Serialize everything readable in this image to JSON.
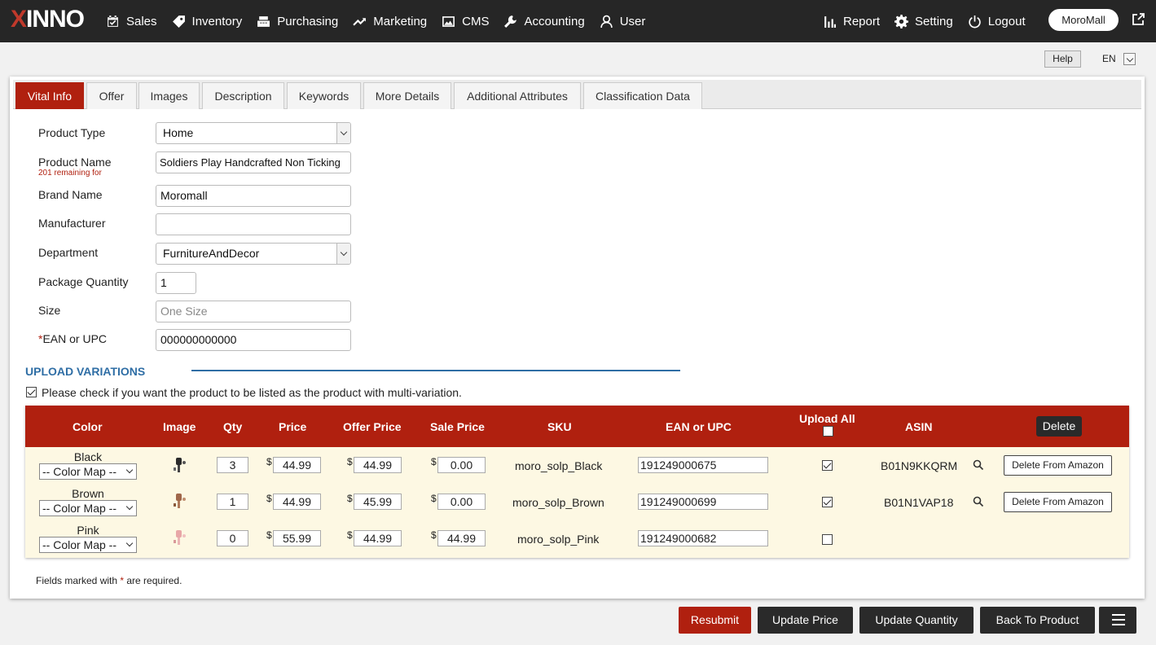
{
  "app": {
    "logo": "XINNO",
    "store": "MoroMall",
    "lang": "EN",
    "help": "Help"
  },
  "nav": {
    "left": [
      {
        "label": "Sales",
        "icon": "calendar-check-icon"
      },
      {
        "label": "Inventory",
        "icon": "tag-icon"
      },
      {
        "label": "Purchasing",
        "icon": "cash-register-icon"
      },
      {
        "label": "Marketing",
        "icon": "trend-line-icon"
      },
      {
        "label": "CMS",
        "icon": "image-icon"
      },
      {
        "label": "Accounting",
        "icon": "wrench-icon"
      },
      {
        "label": "User",
        "icon": "user-icon"
      }
    ],
    "right": [
      {
        "label": "Report",
        "icon": "bar-chart-icon"
      },
      {
        "label": "Setting",
        "icon": "gear-icon"
      },
      {
        "label": "Logout",
        "icon": "power-icon"
      }
    ]
  },
  "tabs": [
    "Vital Info",
    "Offer",
    "Images",
    "Description",
    "Keywords",
    "More Details",
    "Additional Attributes",
    "Classification Data"
  ],
  "form": {
    "product_type": {
      "label": "Product Type",
      "value": "Home"
    },
    "product_name": {
      "label": "Product Name",
      "note": "201 remaining for",
      "value": "Soldiers Play Handcrafted Non Ticking"
    },
    "brand": {
      "label": "Brand Name",
      "value": "Moromall"
    },
    "manufacturer": {
      "label": "Manufacturer",
      "value": ""
    },
    "department": {
      "label": "Department",
      "value": "FurnitureAndDecor"
    },
    "package_qty": {
      "label": "Package Quantity",
      "value": "1"
    },
    "size": {
      "label": "Size",
      "placeholder": "One Size"
    },
    "ean": {
      "label": "EAN or UPC",
      "required_mark": "*",
      "value": "000000000000"
    }
  },
  "variations": {
    "title": "UPLOAD VARIATIONS",
    "multi_label": "Please check if you want the product to be listed as the product with multi-variation.",
    "headers": {
      "color": "Color",
      "image": "Image",
      "qty": "Qty",
      "price": "Price",
      "offer": "Offer Price",
      "sale": "Sale Price",
      "sku": "SKU",
      "ean": "EAN or UPC",
      "upload_all": "Upload All",
      "asin": "ASIN",
      "delete": "Delete"
    },
    "currency": "$",
    "color_map": "-- Color Map --",
    "delete_amazon": "Delete From Amazon",
    "rows": [
      {
        "color": "Black",
        "qty": "3",
        "price": "44.99",
        "offer": "44.99",
        "sale": "0.00",
        "sku": "moro_solp_Black",
        "ean": "191249000675",
        "upload": true,
        "asin": "B01N9KKQRM"
      },
      {
        "color": "Brown",
        "qty": "1",
        "price": "44.99",
        "offer": "45.99",
        "sale": "0.00",
        "sku": "moro_solp_Brown",
        "ean": "191249000699",
        "upload": true,
        "asin": "B01N1VAP18"
      },
      {
        "color": "Pink",
        "qty": "0",
        "price": "55.99",
        "offer": "44.99",
        "sale": "44.99",
        "sku": "moro_solp_Pink",
        "ean": "191249000682",
        "upload": false,
        "asin": ""
      }
    ]
  },
  "footnote": {
    "pre": "Fields marked with ",
    "mark": "*",
    "post": " are required."
  },
  "buttons": {
    "resubmit": "Resubmit",
    "update_price": "Update Price",
    "update_qty": "Update Quantity",
    "back": "Back To Product"
  }
}
